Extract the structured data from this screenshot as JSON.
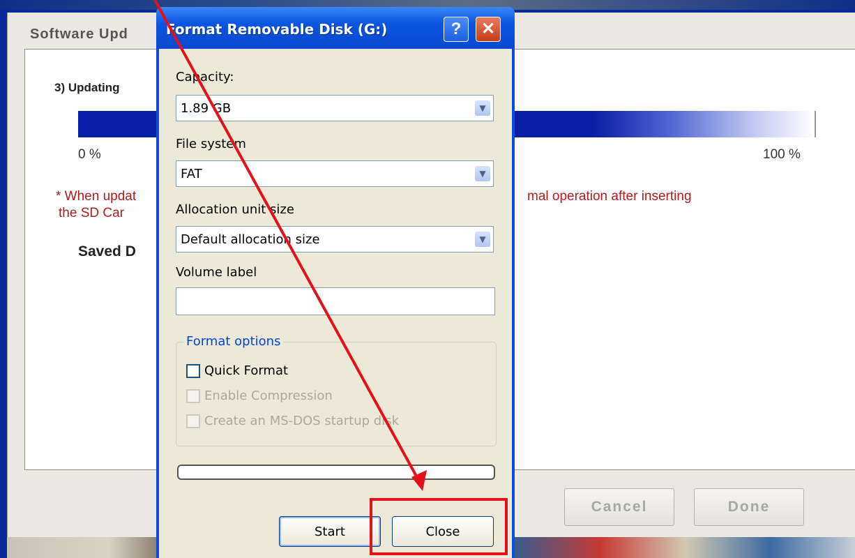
{
  "software_update": {
    "title": "Software Upd",
    "step": "3) Updating",
    "progress": {
      "start_label": "0 %",
      "end_label": "100 %"
    },
    "warning_line1_left": "* When updat",
    "warning_line1_right": "mal operation after inserting",
    "warning_line2": "the SD Car",
    "saved_text": "Saved D",
    "buttons": {
      "cancel": "Cancel",
      "done": "Done"
    }
  },
  "format_dialog": {
    "title": "Format Removable Disk (G:)",
    "help_button": "?",
    "close_x": "✕",
    "capacity": {
      "label": "Capacity:",
      "value": "1.89 GB"
    },
    "file_system": {
      "label": "File system",
      "value": "FAT"
    },
    "allocation": {
      "label": "Allocation unit size",
      "value": "Default allocation size"
    },
    "volume_label": {
      "label": "Volume label",
      "value": ""
    },
    "format_options": {
      "legend": "Format options",
      "quick_format": "Quick Format",
      "enable_compression": "Enable Compression",
      "msdos_disk": "Create an MS-DOS startup disk"
    },
    "buttons": {
      "start": "Start",
      "close": "Close"
    }
  },
  "annotations": {
    "arrow_color": "#e4101a",
    "highlight_color": "#e4101a"
  }
}
